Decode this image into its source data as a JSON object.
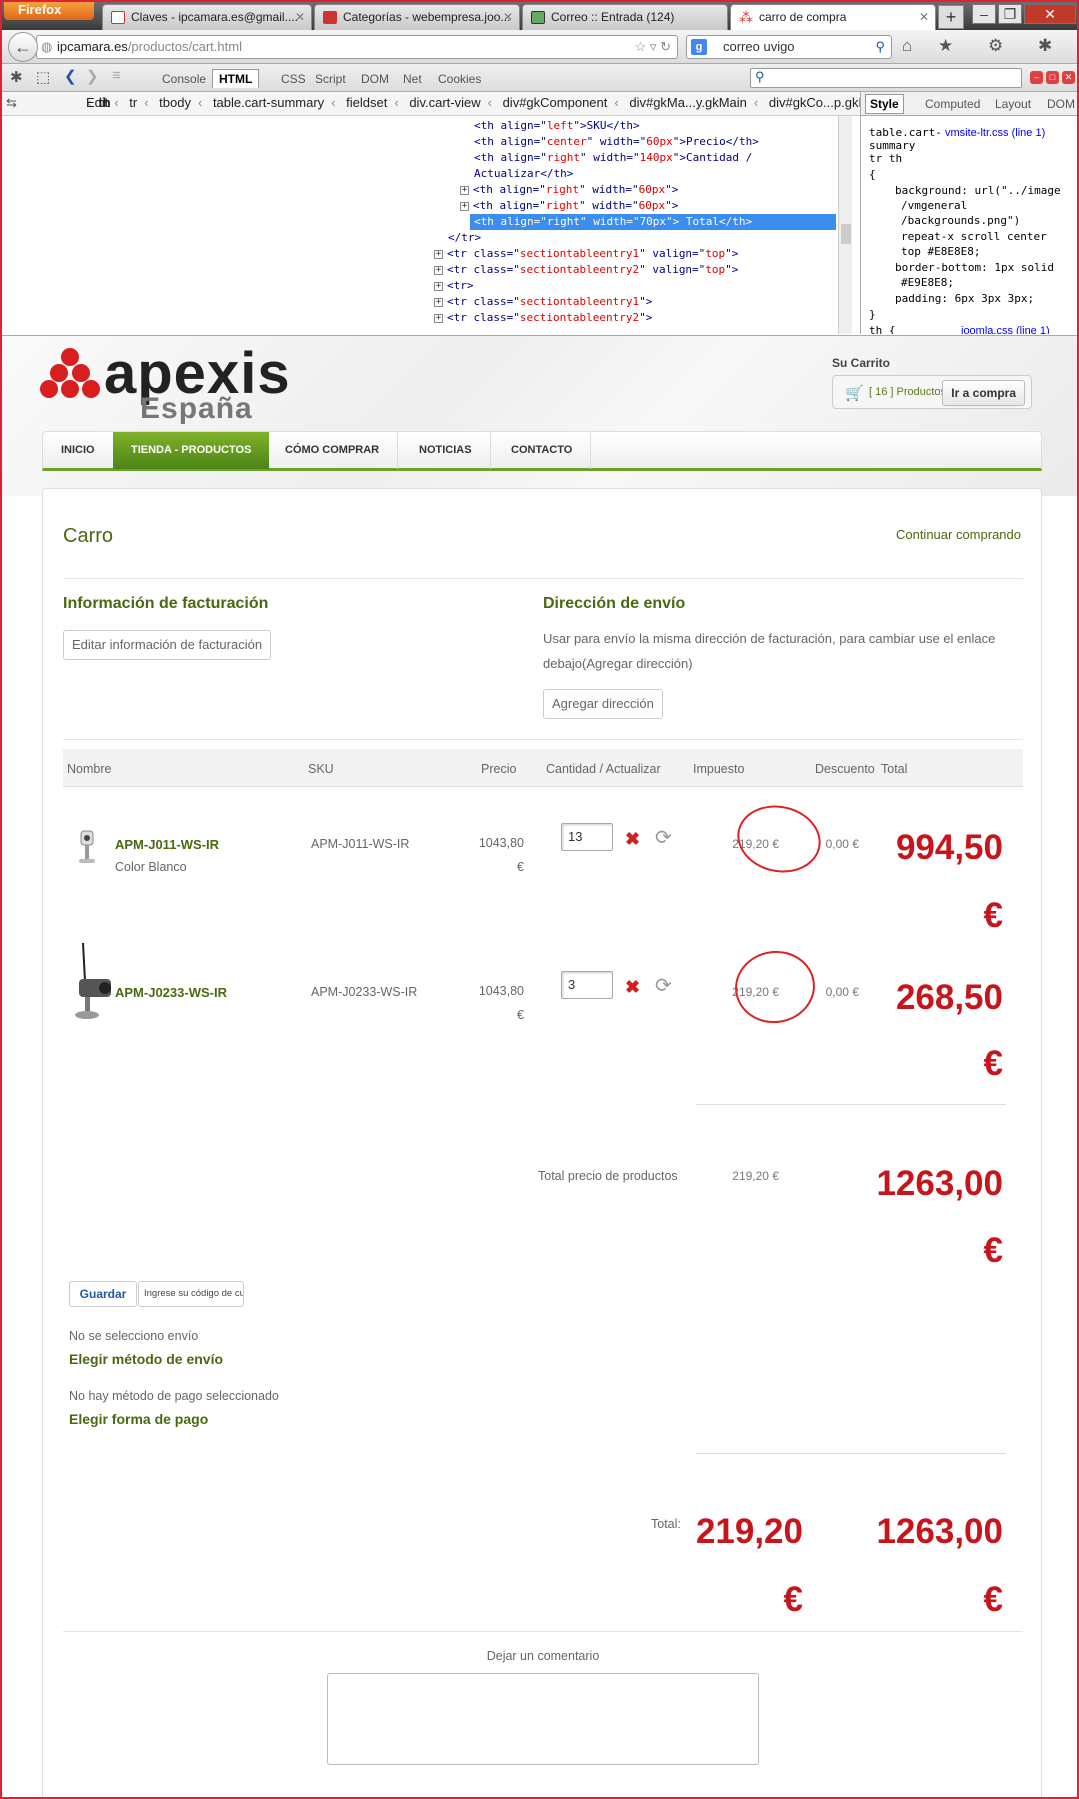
{
  "browser": {
    "app_button": "Firefox",
    "tabs": [
      {
        "title": "Claves - ipcamara.es@gmail...."
      },
      {
        "title": "Categorías - webempresa.joo..."
      },
      {
        "title": "Correo :: Entrada (124)"
      },
      {
        "title": "carro de compra"
      }
    ],
    "url_host": "ipcamara.es",
    "url_path": "/productos/cart.html",
    "search_value": "correo uvigo"
  },
  "firebug": {
    "tabs": [
      "Console",
      "HTML",
      "CSS",
      "Script",
      "DOM",
      "Net",
      "Cookies"
    ],
    "edit_label": "Edit",
    "breadcrumbs": [
      "th",
      "tr",
      "tbody",
      "table.cart-summary",
      "fieldset",
      "div.cart-view",
      "div#gkComponent",
      "div#gkMa...y.gkMain",
      "div#gkCo...p.gkMa"
    ],
    "html_lines": [
      {
        "pre": "<th align=\"",
        "val": "left",
        "post": "\">SKU</th>"
      },
      {
        "pre": "<th align=\"",
        "val": "center",
        "mid": "\" width=\"",
        "val2": "60px",
        "post": "\">Precio</th>"
      },
      {
        "pre": "<th align=\"",
        "val": "right",
        "mid": "\" width=\"",
        "val2": "140px",
        "post": "\">Cantidad /"
      },
      {
        "pre": "Actualizar</th>"
      },
      {
        "pre": "<th align=\"",
        "val": "right",
        "mid": "\" width=\"",
        "val2": "60px",
        "post": "\">"
      },
      {
        "pre": "<th align=\"",
        "val": "right",
        "mid": "\" width=\"",
        "val2": "60px",
        "post": "\">"
      },
      {
        "pre": "<th align=\"right\" width=\"70px\"> Total</th>"
      },
      {
        "pre": "</tr>"
      },
      {
        "pre": "<tr class=\"",
        "val": "sectiontableentry1",
        "mid": "\" valign=\"",
        "val2": "top",
        "post": "\">"
      },
      {
        "pre": "<tr class=\"",
        "val": "sectiontableentry2",
        "mid": "\" valign=\"",
        "val2": "top",
        "post": "\">"
      },
      {
        "pre": "<tr>"
      },
      {
        "pre": "<tr class=\"",
        "val": "sectiontableentry1",
        "post": "\">"
      },
      {
        "pre": "<tr class=\"",
        "val": "sectiontableentry2",
        "post": "\">"
      }
    ],
    "style_tabs": [
      "Style",
      "Computed",
      "Layout",
      "DOM"
    ],
    "style_lines": [
      "table.cart-",
      "summary",
      "tr th",
      "{",
      "background: url(\"../image",
      "/vmgeneral",
      "/backgrounds.png\")",
      "repeat-x scroll center",
      "top #E8E8E8;",
      "border-bottom: 1px solid",
      "#E9E8E8;",
      "padding: 6px 3px 3px;",
      "}",
      "th {"
    ],
    "style_link1": "vmsite-ltr.css (line 1)",
    "style_link2": "joomla.css (line 1)"
  },
  "site": {
    "logo_main": "apexis",
    "logo_sub": "España",
    "cart_label": "Su Carrito",
    "cart_count": "[ 16 ] Productos",
    "cart_button": "Ir a compra",
    "menu": [
      "INICIO",
      "TIENDA - PRODUCTOS",
      "CÓMO COMPRAR",
      "NOTICIAS",
      "CONTACTO"
    ]
  },
  "cart": {
    "title": "Carro",
    "continue": "Continuar comprando",
    "billing_title": "Información de facturación",
    "billing_button": "Editar información de facturación",
    "shipping_title": "Dirección de envío",
    "shipping_text1": "Usar para envío la misma dirección de facturación, para cambiar use el enlace",
    "shipping_text2": "debajo(Agregar dirección)",
    "shipping_button": "Agregar dirección",
    "columns": [
      "Nombre",
      "SKU",
      "Precio",
      "Cantidad / Actualizar",
      "Impuesto",
      "Descuento",
      "Total"
    ],
    "items": [
      {
        "name": "APM-J011-WS-IR",
        "variant": "Color Blanco",
        "sku": "APM-J011-WS-IR",
        "price": "1043,80",
        "currency": "€",
        "qty": "13",
        "tax": "219,20 €",
        "discount": "0,00 €",
        "total": "994,50",
        "total_cur": "€"
      },
      {
        "name": "APM-J0233-WS-IR",
        "variant": "",
        "sku": "APM-J0233-WS-IR",
        "price": "1043,80",
        "currency": "€",
        "qty": "3",
        "tax": "219,20 €",
        "discount": "0,00 €",
        "total": "268,50",
        "total_cur": "€"
      }
    ],
    "subtotal_label": "Total precio de productos",
    "subtotal_tax": "219,20 €",
    "subtotal_total": "1263,00",
    "subtotal_cur": "€",
    "coupon_button": "Guardar",
    "coupon_placeholder": "Ingrese su código de cu",
    "shipping_none": "No se selecciono envío",
    "shipping_link": "Elegir método de envío",
    "payment_none": "No hay método de pago seleccionado",
    "payment_link": "Elegir forma de pago",
    "total_label": "Total:",
    "total_tax": "219,20",
    "total_tax_cur": "€",
    "total_total": "1263,00",
    "total_total_cur": "€",
    "comment_label": "Dejar un comentario"
  },
  "colors": {
    "accent_green": "#4b6810",
    "menu_green": "#6fa022",
    "price_red": "#c8151b"
  }
}
